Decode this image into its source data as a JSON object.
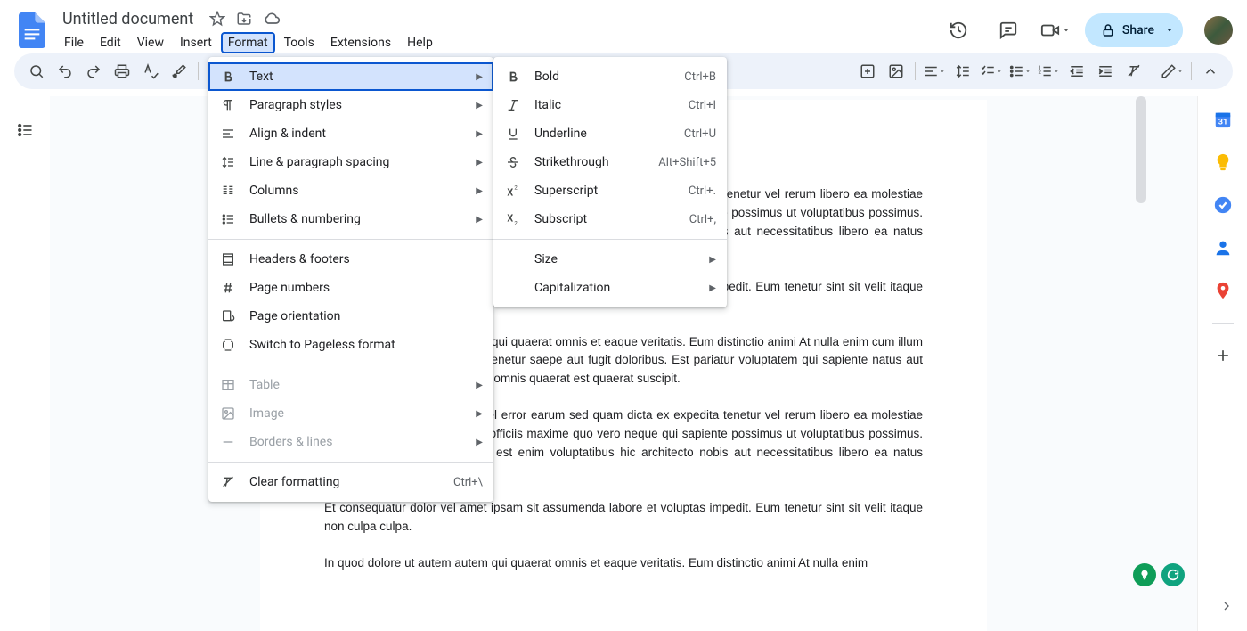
{
  "header": {
    "doc_title": "Untitled document",
    "menus": [
      "File",
      "Edit",
      "View",
      "Insert",
      "Format",
      "Tools",
      "Extensions",
      "Help"
    ],
    "active_menu_index": 4,
    "share_label": "Share"
  },
  "toolbar": {
    "zoom": "1"
  },
  "format_menu": {
    "groups": [
      [
        {
          "icon": "bold",
          "label": "Text",
          "arrow": true,
          "selected": true
        },
        {
          "icon": "paragraph",
          "label": "Paragraph styles",
          "arrow": true
        },
        {
          "icon": "align",
          "label": "Align & indent",
          "arrow": true
        },
        {
          "icon": "linespacing",
          "label": "Line & paragraph spacing",
          "arrow": true
        },
        {
          "icon": "columns",
          "label": "Columns",
          "arrow": true
        },
        {
          "icon": "bullets",
          "label": "Bullets & numbering",
          "arrow": true
        }
      ],
      [
        {
          "icon": "headerfooter",
          "label": "Headers & footers"
        },
        {
          "icon": "hash",
          "label": "Page numbers"
        },
        {
          "icon": "orientation",
          "label": "Page orientation"
        },
        {
          "icon": "pageless",
          "label": "Switch to Pageless format"
        }
      ],
      [
        {
          "icon": "table",
          "label": "Table",
          "arrow": true,
          "disabled": true
        },
        {
          "icon": "image",
          "label": "Image",
          "arrow": true,
          "disabled": true
        },
        {
          "icon": "borders",
          "label": "Borders & lines",
          "arrow": true,
          "disabled": true
        }
      ],
      [
        {
          "icon": "clear",
          "label": "Clear formatting",
          "shortcut": "Ctrl+\\"
        }
      ]
    ]
  },
  "text_submenu": {
    "groups": [
      [
        {
          "icon": "bold",
          "label": "Bold",
          "shortcut": "Ctrl+B"
        },
        {
          "icon": "italic",
          "label": "Italic",
          "shortcut": "Ctrl+I"
        },
        {
          "icon": "underline",
          "label": "Underline",
          "shortcut": "Ctrl+U"
        },
        {
          "icon": "strike",
          "label": "Strikethrough",
          "shortcut": "Alt+Shift+5"
        },
        {
          "icon": "superscript",
          "label": "Superscript",
          "shortcut": "Ctrl+."
        },
        {
          "icon": "subscript",
          "label": "Subscript",
          "shortcut": "Ctrl+,"
        }
      ],
      [
        {
          "label": "Size",
          "arrow": true,
          "noicon": true
        },
        {
          "label": "Capitalization",
          "arrow": true,
          "noicon": true
        }
      ]
    ]
  },
  "document": {
    "paragraphs": [
      "Lorem ipsum dolor sit amet. Vel error earum sed quam dicta ex expedita tenetur vel rerum libero ea molestiae quisquam et quae earum! Qui officiis maxime quo vero neque qui sapiente possimus ut voluptatibus possimus. A possimus dolorem deserunt est enim voluptatibus hic architecto nobis aut necessitatibus libero ea natus saepe qui perspiciatis suscipit.",
      "Et consequatur dolor vel amet ipsam sit assumenda labore et voluptas impedit. Eum tenetur sint sit velit itaque non culpa culpa.",
      "In quod dolore ut autem autem qui quaerat omnis et eaque veritatis. Eum distinctio animi At nulla enim cum illum aliquam et distinctio dolor est tenetur saepe aut fugit doloribus. Est pariatur voluptatem qui sapiente natus aut numquam officia cupiditate quo omnis quaerat est quaerat suscipit.",
      "Lorem ipsum dolor sit amet. Vel error earum sed quam dicta ex expedita tenetur vel rerum libero ea molestiae quisquam et quae earum! Qui officiis maxime quo vero neque qui sapiente possimus ut voluptatibus possimus. A possimus dolorem deserunt est enim voluptatibus hic architecto nobis aut necessitatibus libero ea natus saepe qui perspiciatis suscipit.",
      "Et consequatur dolor vel amet ipsam sit assumenda labore et voluptas impedit. Eum tenetur sint sit velit itaque non culpa culpa.",
      "In quod dolore ut autem autem qui quaerat omnis et eaque veritatis. Eum distinctio animi At nulla enim"
    ]
  }
}
